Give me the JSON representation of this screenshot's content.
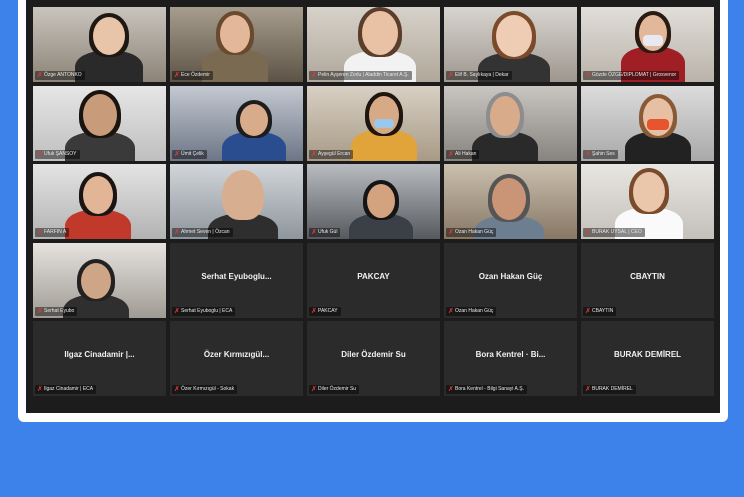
{
  "meeting": {
    "colors": {
      "page_background": "#3d82ea",
      "window": "#ffffff",
      "grid_background": "#1c1c1c",
      "tile_background": "#2b2b2b",
      "active_speaker_border": "#8fd14f",
      "muted_mic": "#e53935"
    },
    "video_tiles": [
      {
        "label": "Özge ANTONKO"
      },
      {
        "label": "Ece Özdemir"
      },
      {
        "label": "Pelin Ayşeren Zorlu | Aladdin Ticaret A.Ş."
      },
      {
        "label": "Elif B. Saylıkaya | Dekar"
      },
      {
        "label": "Gözde ÖZGE/DIPLOMAT | Grosvenor"
      },
      {
        "label": "Ufuk ŞANSOY"
      },
      {
        "label": "Ümit Çelik"
      },
      {
        "label": "Ayşegül Ercan"
      },
      {
        "label": "Ali Hakan"
      },
      {
        "label": "Şahin Ses"
      },
      {
        "label": "FARFIN A"
      },
      {
        "label": "Ahmet Seven | Özcan"
      },
      {
        "label": "Ufuk Gül"
      },
      {
        "label": "Ozan Hakan Güç"
      },
      {
        "label": "BURAK UYSAL | CEO"
      },
      {
        "label": "Serhat Eyubo"
      }
    ],
    "name_tiles": [
      {
        "name": "Serhat Eyuboglu...",
        "label": "Serhat Eyuboglu | ECA"
      },
      {
        "name": "PAKCAY",
        "label": "PAKCAY"
      },
      {
        "name": "Ozan Hakan Güç",
        "label": "Ozan Hakan Güç"
      },
      {
        "name": "CBAYTIN",
        "label": "CBAYTIN"
      },
      {
        "name": "Ilgaz Cinadamir |...",
        "label": "Ilgaz Cinadamir | ECA"
      },
      {
        "name": "Özer Kırmızıgül...",
        "label": "Özer Kırmızıgül - Sokak"
      },
      {
        "name": "Diler Özdemir Su",
        "label": "Diler Özdemir Su"
      },
      {
        "name": "Bora Kentrel · Bi...",
        "label": "Bora Kentrel - Bilgi Sanayi A.Ş."
      },
      {
        "name": "BURAK DEMİREL",
        "label": "BURAK DEMİREL"
      }
    ]
  }
}
